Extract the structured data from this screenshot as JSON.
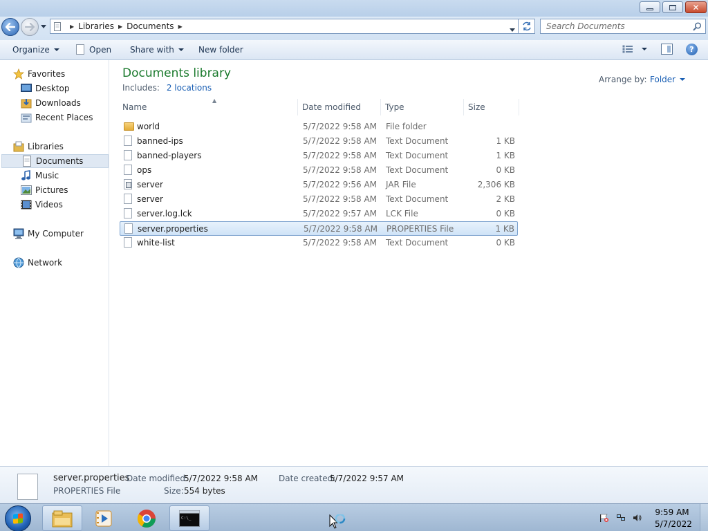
{
  "window": {
    "minimize_icon": "minimize-icon",
    "maximize_icon": "restore-icon",
    "close_icon": "close-icon",
    "close_color": "#c84b2e"
  },
  "address": {
    "crumbs": [
      "Libraries",
      "Documents"
    ],
    "search_placeholder": "Search Documents"
  },
  "toolbar": {
    "organize": "Organize",
    "open": "Open",
    "share_with": "Share with",
    "new_folder": "New folder"
  },
  "sidebar": {
    "favorites": {
      "label": "Favorites",
      "items": [
        "Desktop",
        "Downloads",
        "Recent Places"
      ]
    },
    "libraries": {
      "label": "Libraries",
      "items": [
        "Documents",
        "Music",
        "Pictures",
        "Videos"
      ]
    },
    "computer": "My Computer",
    "network": "Network"
  },
  "library": {
    "title": "Documents library",
    "includes_label": "Includes:",
    "locations_link": "2 locations",
    "arrange_label": "Arrange by:",
    "arrange_value": "Folder",
    "title_color": "#1b7a2d"
  },
  "columns": {
    "name": "Name",
    "date": "Date modified",
    "type": "Type",
    "size": "Size"
  },
  "files": [
    {
      "icon": "folder-icon",
      "name": "world",
      "date": "5/7/2022 9:58 AM",
      "type": "File folder",
      "size": ""
    },
    {
      "icon": "text-file-icon",
      "name": "banned-ips",
      "date": "5/7/2022 9:58 AM",
      "type": "Text Document",
      "size": "1 KB"
    },
    {
      "icon": "text-file-icon",
      "name": "banned-players",
      "date": "5/7/2022 9:58 AM",
      "type": "Text Document",
      "size": "1 KB"
    },
    {
      "icon": "text-file-icon",
      "name": "ops",
      "date": "5/7/2022 9:58 AM",
      "type": "Text Document",
      "size": "0 KB"
    },
    {
      "icon": "jar-file-icon",
      "name": "server",
      "date": "5/7/2022 9:56 AM",
      "type": "JAR File",
      "size": "2,306 KB"
    },
    {
      "icon": "text-file-icon",
      "name": "server",
      "date": "5/7/2022 9:58 AM",
      "type": "Text Document",
      "size": "2 KB"
    },
    {
      "icon": "file-icon",
      "name": "server.log.lck",
      "date": "5/7/2022 9:57 AM",
      "type": "LCK File",
      "size": "0 KB"
    },
    {
      "icon": "file-icon",
      "name": "server.properties",
      "date": "5/7/2022 9:58 AM",
      "type": "PROPERTIES File",
      "size": "1 KB",
      "selected": true
    },
    {
      "icon": "text-file-icon",
      "name": "white-list",
      "date": "5/7/2022 9:58 AM",
      "type": "Text Document",
      "size": "0 KB"
    }
  ],
  "details": {
    "name": "server.properties",
    "type": "PROPERTIES File",
    "modified_label": "Date modified:",
    "modified_value": "5/7/2022 9:58 AM",
    "created_label": "Date created:",
    "created_value": "5/7/2022 9:57 AM",
    "size_label": "Size:",
    "size_value": "554 bytes"
  },
  "taskbar": {
    "apps": [
      "windows-explorer-icon",
      "media-player-icon",
      "chrome-icon",
      "command-prompt-icon"
    ],
    "clock_time": "9:59 AM",
    "clock_date": "5/7/2022"
  }
}
